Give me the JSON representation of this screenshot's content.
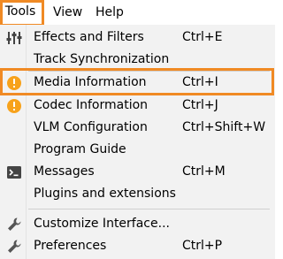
{
  "menubar": {
    "tools": "Tools",
    "view": "View",
    "help": "Help"
  },
  "menu": {
    "items": [
      {
        "label": "Effects and Filters",
        "shortcut": "Ctrl+E",
        "icon": "equalizer-icon"
      },
      {
        "label": "Track Synchronization",
        "shortcut": "",
        "icon": ""
      },
      {
        "label": "Media Information",
        "shortcut": "Ctrl+I",
        "icon": "info-icon"
      },
      {
        "label": "Codec Information",
        "shortcut": "Ctrl+J",
        "icon": "info-icon"
      },
      {
        "label": "VLM Configuration",
        "shortcut": "Ctrl+Shift+W",
        "icon": ""
      },
      {
        "label": "Program Guide",
        "shortcut": "",
        "icon": ""
      },
      {
        "label": "Messages",
        "shortcut": "Ctrl+M",
        "icon": "terminal-icon"
      },
      {
        "label": "Plugins and extensions",
        "shortcut": "",
        "icon": ""
      },
      {
        "label": "Customize Interface...",
        "shortcut": "",
        "icon": "wrench-icon"
      },
      {
        "label": "Preferences",
        "shortcut": "Ctrl+P",
        "icon": "wrench-icon"
      }
    ]
  },
  "colors": {
    "highlight_border": "#f08a24",
    "info_icon": "#f7a21b",
    "menu_background": "#f2f2f2"
  }
}
